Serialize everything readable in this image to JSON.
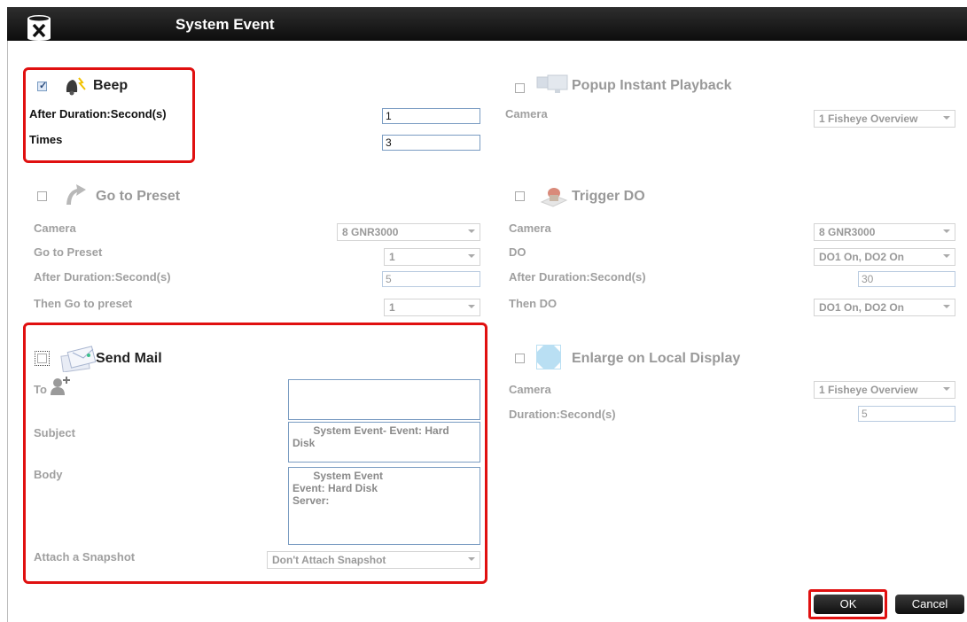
{
  "window": {
    "title": "System Event"
  },
  "beep": {
    "title": "Beep",
    "checked": true,
    "after_duration_label": "After Duration:Second(s)",
    "after_duration_value": "1",
    "times_label": "Times",
    "times_value": "3"
  },
  "popup": {
    "title": "Popup Instant Playback",
    "camera_label": "Camera",
    "camera_value": "1 Fisheye Overview"
  },
  "preset": {
    "title": "Go to Preset",
    "camera_label": "Camera",
    "camera_value": "8 GNR3000",
    "preset_label": "Go to Preset",
    "preset_value": "1",
    "after_label": "After Duration:Second(s)",
    "after_value": "5",
    "then_label": "Then Go to preset",
    "then_value": "1"
  },
  "trigger": {
    "title": "Trigger DO",
    "camera_label": "Camera",
    "camera_value": "8 GNR3000",
    "do_label": "DO",
    "do_value": "DO1 On, DO2 On",
    "after_label": "After Duration:Second(s)",
    "after_value": "30",
    "then_label": "Then DO",
    "then_value": "DO1 On, DO2 On"
  },
  "mail": {
    "title": "Send Mail",
    "to_label": "To",
    "to_value": "",
    "subject_label": "Subject",
    "subject_value": "       System Event- Event: Hard\nDisk",
    "body_label": "Body",
    "body_value": "       System Event\nEvent: Hard Disk\nServer:",
    "snapshot_label": "Attach a Snapshot",
    "snapshot_value": "Don't Attach Snapshot"
  },
  "enlarge": {
    "title": "Enlarge on Local Display",
    "camera_label": "Camera",
    "camera_value": "1 Fisheye Overview",
    "duration_label": "Duration:Second(s)",
    "duration_value": "5"
  },
  "buttons": {
    "ok": "OK",
    "cancel": "Cancel"
  },
  "colors": {
    "highlight": "#e01010",
    "titlebar": "#1a1a1a"
  },
  "icons": {
    "logo": "database-x-icon",
    "beep": "bell-alarm-icon",
    "popup": "monitors-icon",
    "preset": "arrow-curve-icon",
    "trigger": "io-device-icon",
    "mail": "envelope-icon",
    "to": "add-person-icon",
    "enlarge": "expand-icon"
  }
}
